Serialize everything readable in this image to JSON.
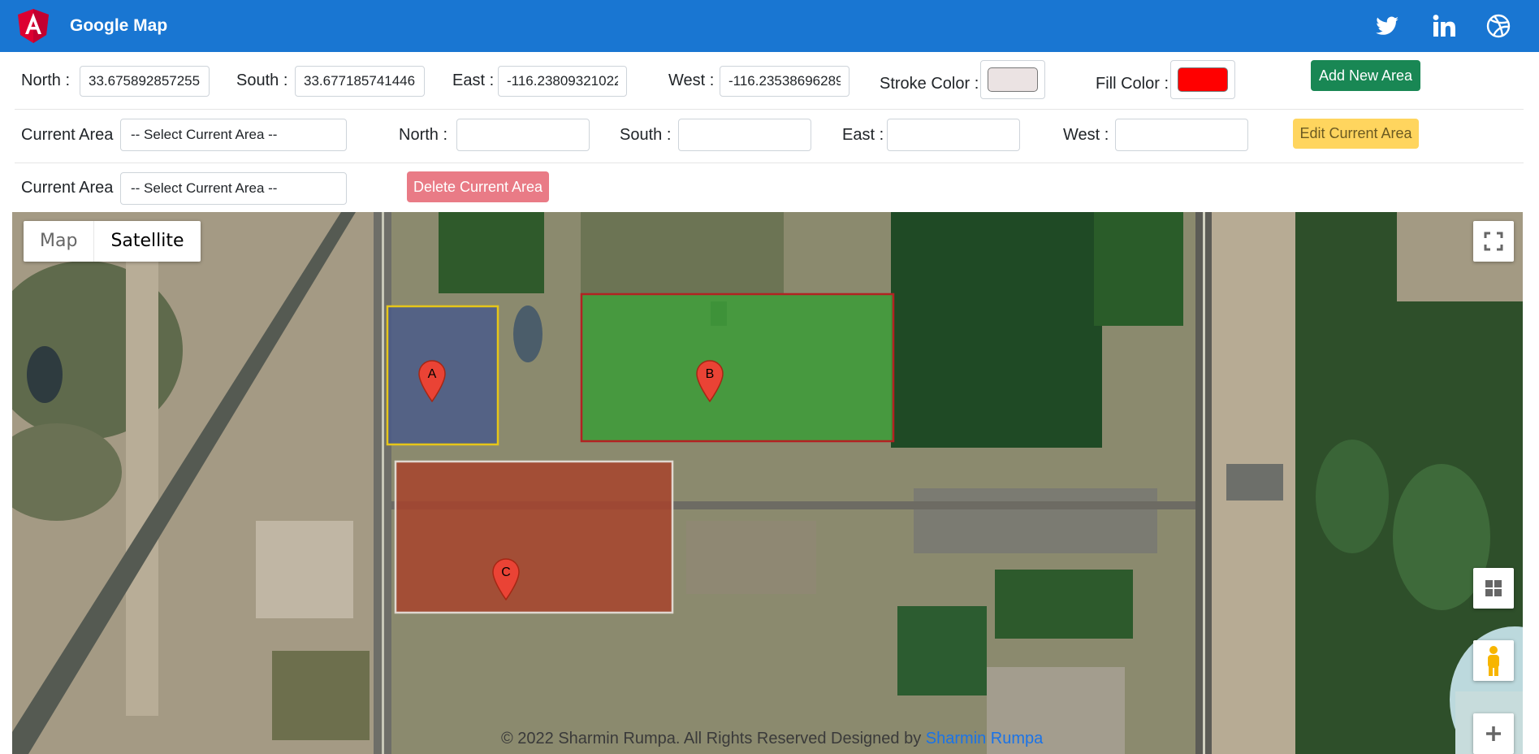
{
  "header": {
    "brand": "Google Map",
    "social": [
      "twitter-icon",
      "linkedin-icon",
      "dribbble-icon"
    ]
  },
  "add_form": {
    "north_label": "North :",
    "north_value": "33.675892857255",
    "south_label": "South :",
    "south_value": "33.677185741446",
    "east_label": "East :",
    "east_value": "-116.23809321022",
    "west_label": "West :",
    "west_value": "-116.23538696289",
    "stroke_label": "Stroke Color :",
    "stroke_color": "#ebe3e3",
    "fill_label": "Fill Color :",
    "fill_color": "#ff0000",
    "add_button": "Add New Area"
  },
  "edit_form": {
    "current_area_label": "Current Area",
    "current_area_select": "-- Select Current Area --",
    "north_label": "North :",
    "south_label": "South :",
    "east_label": "East :",
    "west_label": "West :",
    "edit_button": "Edit Current Area"
  },
  "delete_form": {
    "current_area_label": "Current Area",
    "current_area_select": "-- Select Current Area --",
    "delete_button": "Delete Current Area"
  },
  "map": {
    "type_map": "Map",
    "type_satellite": "Satellite",
    "selected_type": "Satellite",
    "areas": [
      {
        "label": "A",
        "fill": "#4a5a8a",
        "stroke": "#e6c619"
      },
      {
        "label": "B",
        "fill": "#3f9a3a",
        "stroke": "#b22222"
      },
      {
        "label": "C",
        "fill": "#a8412a",
        "stroke": "#e0d7d0"
      }
    ],
    "controls": [
      "fullscreen-icon",
      "grid-icon",
      "pegman-icon",
      "zoom-in-icon"
    ]
  },
  "footer": {
    "text": "© 2022 Sharmin Rumpa. All Rights Reserved Designed by",
    "link": "Sharmin Rumpa"
  },
  "colors": {
    "header": "#1976d2",
    "add_button": "#198754",
    "edit_button": "#ffc107",
    "delete_button": "#dc3545"
  }
}
